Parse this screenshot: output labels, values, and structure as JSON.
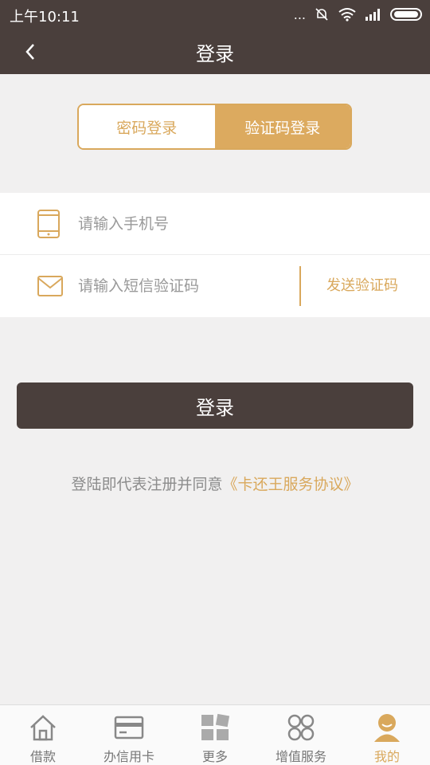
{
  "status_bar": {
    "time": "上午10:11",
    "signal_text": "..."
  },
  "header": {
    "title": "登录",
    "back_icon": "chevron-left-icon"
  },
  "login_tabs": [
    {
      "label": "密码登录",
      "active": false
    },
    {
      "label": "验证码登录",
      "active": true
    }
  ],
  "form": {
    "phone_placeholder": "请输入手机号",
    "code_placeholder": "请输入短信验证码",
    "send_code_label": "发送验证码"
  },
  "login_button": "登录",
  "agreement": {
    "prefix": "登陆即代表注册并同意",
    "link": "《卡还王服务协议》"
  },
  "bottom_tabs": [
    {
      "label": "借款",
      "icon": "home-icon",
      "active": false
    },
    {
      "label": "办信用卡",
      "icon": "credit-card-icon",
      "active": false
    },
    {
      "label": "更多",
      "icon": "grid-icon",
      "active": false
    },
    {
      "label": "增值服务",
      "icon": "clover-icon",
      "active": false
    },
    {
      "label": "我的",
      "icon": "user-icon",
      "active": true
    }
  ],
  "colors": {
    "primary_dark": "#4a3f3c",
    "accent": "#d9a85c",
    "background": "#f1f0f0"
  }
}
